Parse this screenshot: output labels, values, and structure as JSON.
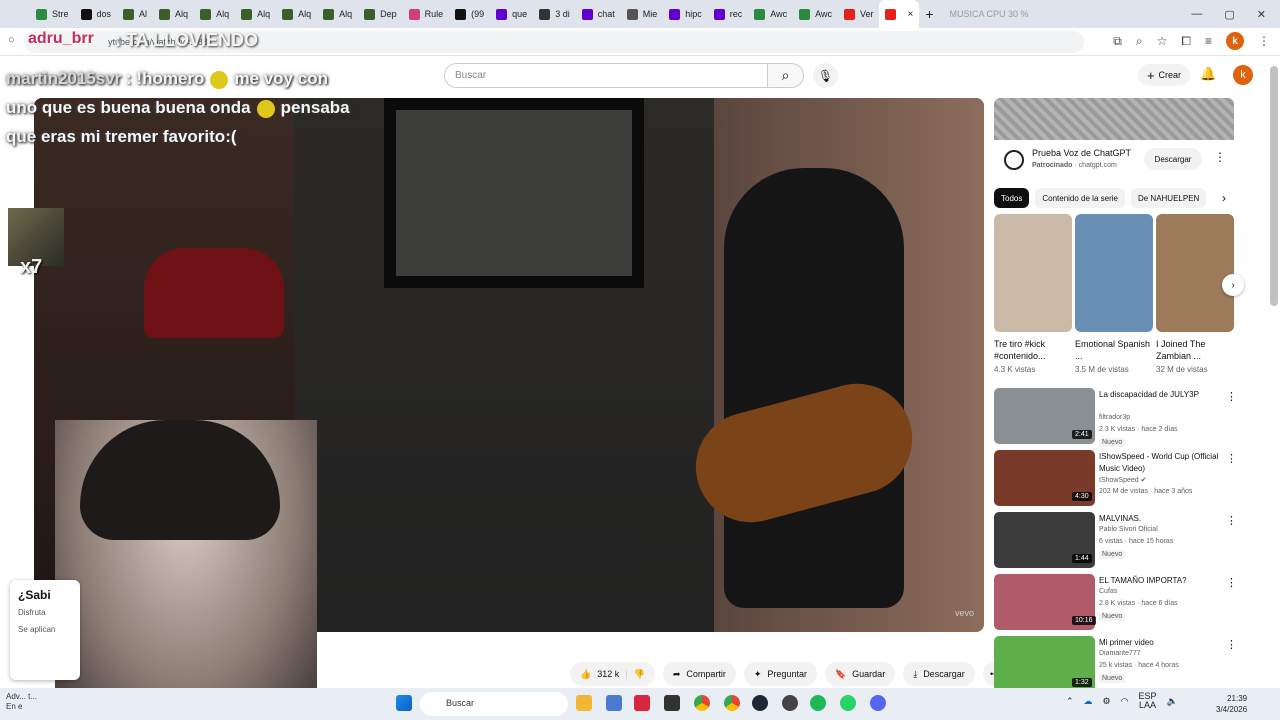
{
  "browser": {
    "tabs": [
      {
        "label": "Stre",
        "color": "#2b8a3e"
      },
      {
        "label": "dos",
        "color": "#111111"
      },
      {
        "label": "Al",
        "color": "#3a5f2b"
      },
      {
        "label": "Alq",
        "color": "#3a5f2b"
      },
      {
        "label": "Alq",
        "color": "#3a5f2b"
      },
      {
        "label": "Alq",
        "color": "#3a5f2b"
      },
      {
        "label": "Alq",
        "color": "#3a5f2b"
      },
      {
        "label": "Alq",
        "color": "#3a5f2b"
      },
      {
        "label": "Dep",
        "color": "#3a5f2b"
      },
      {
        "label": "Rule",
        "color": "#d13f7a"
      },
      {
        "label": "(99",
        "color": "#111111"
      },
      {
        "label": "que",
        "color": "#6001d2"
      },
      {
        "label": "3 di",
        "color": "#333333"
      },
      {
        "label": "chat",
        "color": "#6001d2"
      },
      {
        "label": "Mie",
        "color": "#555555"
      },
      {
        "label": "hipc",
        "color": "#6001d2"
      },
      {
        "label": "rec",
        "color": "#6001d2"
      },
      {
        "label": "Awc",
        "color": "#2b8a3e"
      },
      {
        "label": "Awc",
        "color": "#2b8a3e"
      },
      {
        "label": "Ver",
        "color": "#e62117"
      }
    ],
    "active_tab_close": "×",
    "new_tab": "+",
    "overlay_stats": "MUSICA   CPU 30 %"
  },
  "address": {
    "url_fragment": "ytube.com/watch?v=...88"
  },
  "stream_overlay": {
    "top_user": "adru_brr",
    "top_message": ": TA LLOVIENDO",
    "chat_user": "martin2015svr",
    "chat_line1": ": !homero",
    "chat_line1b": "me voy con",
    "chat_line2": "uno que es buena buena onda",
    "chat_line2b": "pensaba",
    "chat_line3": "que eras mi tremer favorito:(",
    "multiplier": "x7",
    "popup_title": "¿Sabi",
    "popup_line1": "Disfruta",
    "popup_line2": "Se aplican"
  },
  "youtube": {
    "search_placeholder": "Buscar",
    "create_label": "Crear",
    "avatar_letter": "k",
    "watermark": "vevo",
    "actions": {
      "likes": "312 k",
      "share": "Compartir",
      "ask": "Preguntar",
      "save": "Guardar",
      "download": "Descargar",
      "more": "•••"
    },
    "ad": {
      "title": "Prueba Voz de ChatGPT",
      "sponsored": "Patrocinado",
      "domain": "· chatgpt.com",
      "button": "Descargar"
    },
    "chips": [
      "Todos",
      "Contenido de la serie",
      "De NAHUELPEN"
    ],
    "shorts": [
      {
        "title": "Tre tiro #kick #contenido...",
        "views": "4.3 K vistas",
        "color": "#c9b9a6"
      },
      {
        "title": "Emotional Spanish ...",
        "views": "3.5 M de vistas",
        "color": "#6a8fb4"
      },
      {
        "title": "I Joined The Zambian ...",
        "views": "32 M de vistas",
        "color": "#9c7a5a"
      }
    ],
    "videos": [
      {
        "title": "La discapacidad de JULY3P",
        "channel": "filtrador3p",
        "meta": "2.3 K vistas · hace 2 días",
        "badge": "Nuevo",
        "duration": "2:41",
        "color": "#8a8f93"
      },
      {
        "title": "IShowSpeed - World Cup (Official Music Video)",
        "channel": "IShowSpeed ✔",
        "meta": "202 M de vistas · hace 3 años",
        "badge": "",
        "duration": "4:30",
        "color": "#7a3a2a"
      },
      {
        "title": "MALVINAS.",
        "channel": "Pablo Sivori Oficial",
        "meta": "6 vistas · hace 15 horas",
        "badge": "Nuevo",
        "duration": "1:44",
        "color": "#3b3b3b"
      },
      {
        "title": "EL TAMAÑO IMPORTA?",
        "channel": "Cufas",
        "meta": "2.8 K vistas · hace 6 días",
        "badge": "Nuevo",
        "duration": "10:16",
        "color": "#b05a6a"
      },
      {
        "title": "Mi primer video",
        "channel": "Diamante777",
        "meta": "25 k vistas · hace 4 horas",
        "badge": "Nuevo",
        "duration": "1:32",
        "color": "#5fae4c"
      }
    ]
  },
  "taskbar": {
    "weather_line1": "Adv... t...",
    "weather_line2": "En e",
    "search": "Buscar",
    "lang1": "ESP",
    "lang2": "LAA",
    "time": "21:39",
    "date": "3/4/2026"
  }
}
